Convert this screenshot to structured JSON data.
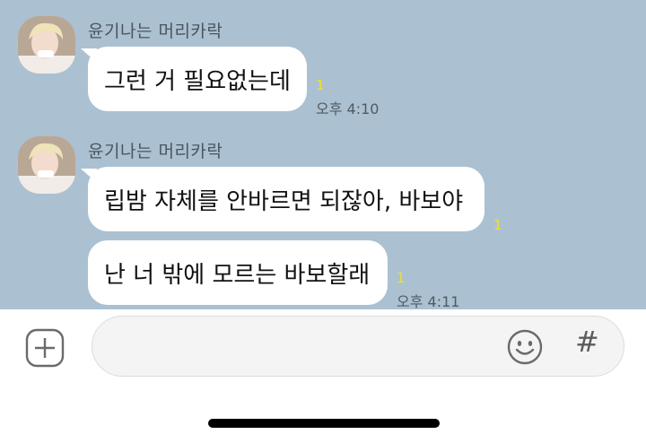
{
  "messages": [
    {
      "sender": "윤기나는 머리카락",
      "bubbles": [
        {
          "text": "그런 거 필요없는데",
          "unread": "1",
          "time": "오후 4:10"
        }
      ]
    },
    {
      "sender": "윤기나는 머리카락",
      "bubbles": [
        {
          "text": "립밤 자체를 안바르면 되잖아, 바보야",
          "unread": "1",
          "time": ""
        },
        {
          "text": "난 너 밖에 모르는 바보할래",
          "unread": "1",
          "time": "오후 4:11"
        }
      ]
    }
  ],
  "input": {
    "placeholder": "",
    "plus_icon": "plus-icon",
    "emoji_icon": "emoji-icon",
    "hash_label": "#"
  },
  "colors": {
    "chat_background": "#abc1d1",
    "bubble": "#ffffff",
    "unread": "#f5e11c"
  }
}
